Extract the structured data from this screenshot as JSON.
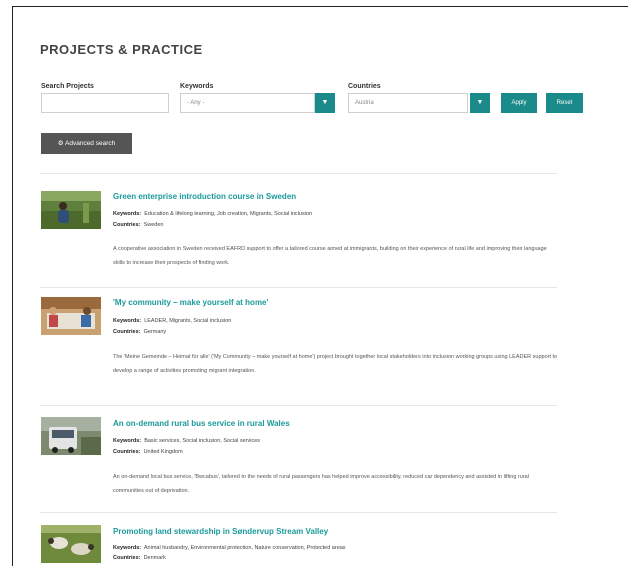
{
  "page": {
    "title": "PROJECTS & PRACTICE"
  },
  "search": {
    "search_label": "Search Projects",
    "search_value": "",
    "keywords_label": "Keywords",
    "keywords_value": "- Any -",
    "countries_label": "Countries",
    "countries_value": "Austria",
    "apply_label": "Apply",
    "reset_label": "Reset",
    "advanced_label": "⚙ Advanced search",
    "dropdown_icon": "▼"
  },
  "labels": {
    "keywords": "Keywords:",
    "countries": "Countries:"
  },
  "projects": [
    {
      "title": "Green enterprise introduction course in Sweden",
      "keywords": "Education & lifelong learning, Job creation, Migrants, Social inclusion",
      "countries": "Sweden",
      "description": "A cooperative association in Sweden received EAFRD support to offer a tailored course aimed at immigrants, building on their experience of rural life and improving their language skills to increase their prospects of finding work.",
      "thumb": "person-planting"
    },
    {
      "title": "'My community – make yourself at home'",
      "keywords": "LEADER, Migrants, Social inclusion",
      "countries": "Germany",
      "description": "The 'Meine Gemeinde – Heimat für alle' ('My Community – make yourself at home') project brought together local stakeholders into inclusion working groups using LEADER support to develop a range of activities promoting migrant integration.",
      "thumb": "meeting-table"
    },
    {
      "title": "An on-demand rural bus service in rural Wales",
      "keywords": "Basic services, Social inclusion, Social services",
      "countries": "United Kingdom",
      "description": "An on-demand local bus service, 'Bwcabus', tailored to the needs of rural passengers has helped improve accessibility, reduced car dependency and assisted in lifting rural communities out of deprivation.",
      "thumb": "bus"
    },
    {
      "title": "Promoting land stewardship in Søndervup Stream Valley",
      "keywords": "Animal husbandry, Environmental protection, Nature conservation, Protected areas",
      "countries": "Denmark",
      "description": "",
      "thumb": "sheep"
    }
  ]
}
